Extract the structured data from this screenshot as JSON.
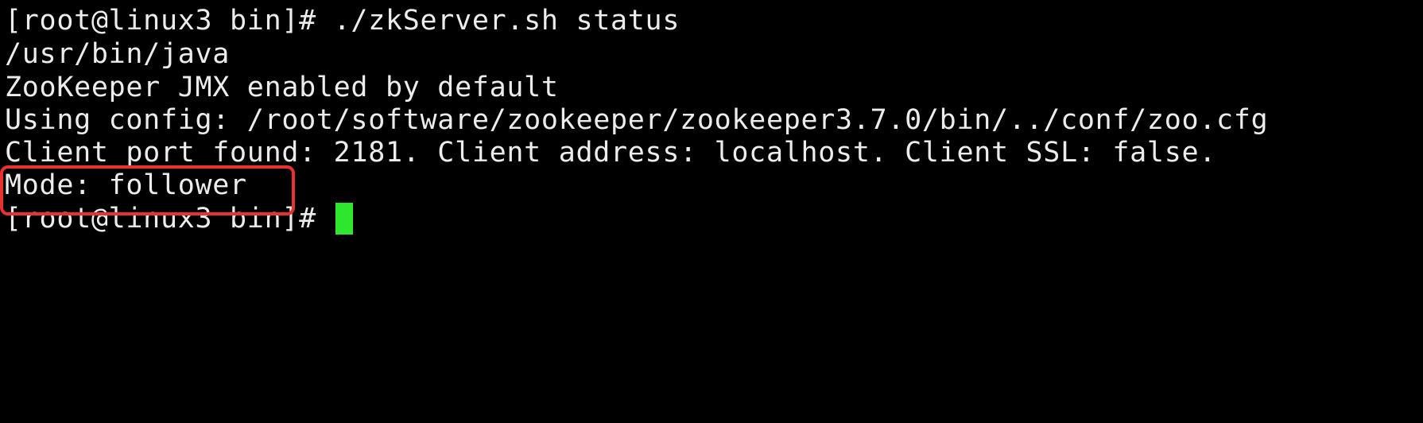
{
  "terminal": {
    "background_color": "#000000",
    "text_color": "#ececec",
    "lines": [
      "[root@linux3 bin]# ./zkServer.sh status",
      "/usr/bin/java",
      "ZooKeeper JMX enabled by default",
      "Using config: /root/software/zookeeper/zookeeper3.7.0/bin/../conf/zoo.cfg",
      "Client port found: 2181. Client address: localhost. Client SSL: false.",
      "Mode: follower",
      "[root@linux3 bin]# "
    ],
    "cursor_color": "#2ee62e",
    "highlight_color": "#e8322f"
  }
}
